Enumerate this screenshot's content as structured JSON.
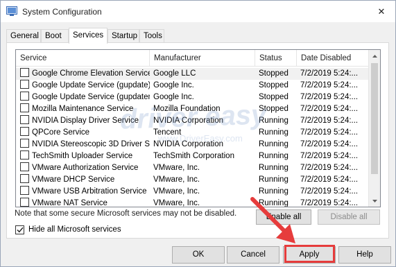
{
  "window": {
    "title": "System Configuration",
    "close_glyph": "✕"
  },
  "tabs": [
    {
      "label": "General"
    },
    {
      "label": "Boot"
    },
    {
      "label": "Services",
      "active": true
    },
    {
      "label": "Startup"
    },
    {
      "label": "Tools"
    }
  ],
  "services_list": {
    "columns": [
      "Service",
      "Manufacturer",
      "Status",
      "Date Disabled"
    ],
    "rows": [
      {
        "service": "Google Chrome Elevation Service",
        "manufacturer": "Google LLC",
        "status": "Stopped",
        "date": "7/2/2019 5:24:..."
      },
      {
        "service": "Google Update Service (gupdate)",
        "manufacturer": "Google Inc.",
        "status": "Stopped",
        "date": "7/2/2019 5:24:..."
      },
      {
        "service": "Google Update Service (gupdatem)",
        "manufacturer": "Google Inc.",
        "status": "Stopped",
        "date": "7/2/2019 5:24:..."
      },
      {
        "service": "Mozilla Maintenance Service",
        "manufacturer": "Mozilla Foundation",
        "status": "Stopped",
        "date": "7/2/2019 5:24:..."
      },
      {
        "service": "NVIDIA Display Driver Service",
        "manufacturer": "NVIDIA Corporation",
        "status": "Running",
        "date": "7/2/2019 5:24:..."
      },
      {
        "service": "QPCore Service",
        "manufacturer": "Tencent",
        "status": "Running",
        "date": "7/2/2019 5:24:..."
      },
      {
        "service": "NVIDIA Stereoscopic 3D Driver S...",
        "manufacturer": "NVIDIA Corporation",
        "status": "Running",
        "date": "7/2/2019 5:24:..."
      },
      {
        "service": "TechSmith Uploader Service",
        "manufacturer": "TechSmith Corporation",
        "status": "Running",
        "date": "7/2/2019 5:24:..."
      },
      {
        "service": "VMware Authorization Service",
        "manufacturer": "VMware, Inc.",
        "status": "Running",
        "date": "7/2/2019 5:24:..."
      },
      {
        "service": "VMware DHCP Service",
        "manufacturer": "VMware, Inc.",
        "status": "Running",
        "date": "7/2/2019 5:24:..."
      },
      {
        "service": "VMware USB Arbitration Service",
        "manufacturer": "VMware, Inc.",
        "status": "Running",
        "date": "7/2/2019 5:24:..."
      },
      {
        "service": "VMware NAT Service",
        "manufacturer": "VMware, Inc.",
        "status": "Running",
        "date": "7/2/2019 5:24:..."
      }
    ]
  },
  "watermark": {
    "brand": "driver easy",
    "url": "www.DriverEasy.com"
  },
  "note": "Note that some secure Microsoft services may not be disabled.",
  "enable_all_label": "Enable all",
  "disable_all_label": "Disable all",
  "hide_ms_label": "Hide all Microsoft services",
  "hide_ms_checked": true,
  "buttons": {
    "ok": "OK",
    "cancel": "Cancel",
    "apply": "Apply",
    "help": "Help"
  },
  "colors": {
    "annotation": "#e63c3c"
  }
}
